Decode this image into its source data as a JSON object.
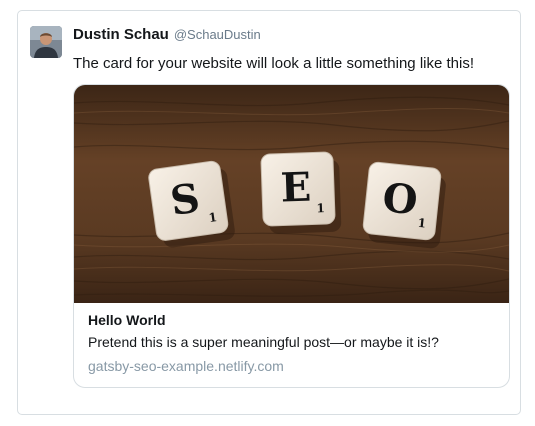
{
  "tweet": {
    "author": {
      "display_name": "Dustin Schau",
      "handle": "@SchauDustin"
    },
    "text": "The card for your website will look a little something like this!",
    "card": {
      "image": {
        "tiles": [
          {
            "letter": "S",
            "subscript": "1"
          },
          {
            "letter": "E",
            "subscript": "1"
          },
          {
            "letter": "O",
            "subscript": "1"
          }
        ]
      },
      "title": "Hello World",
      "description": "Pretend this is a super meaningful post—or maybe it is!?",
      "domain": "gatsby-seo-example.netlify.com"
    }
  },
  "colors": {
    "border": "#d8dee2",
    "text": "#14171a",
    "handle": "#6a7b8a",
    "domain": "#8899a6",
    "wood": "#5a3a22",
    "tile": "#efe6da"
  }
}
